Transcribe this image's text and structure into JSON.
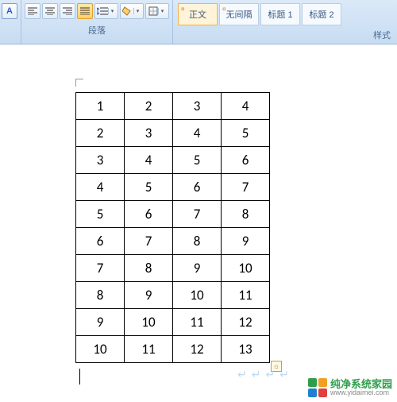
{
  "ribbon": {
    "paragraph_label": "段落",
    "styles_label": "样式",
    "styles": [
      "正文",
      "无间隔",
      "标题 1",
      "标题 2"
    ]
  },
  "table": {
    "rows": [
      [
        "1",
        "2",
        "3",
        "4"
      ],
      [
        "2",
        "3",
        "4",
        "5"
      ],
      [
        "3",
        "4",
        "5",
        "6"
      ],
      [
        "4",
        "5",
        "6",
        "7"
      ],
      [
        "5",
        "6",
        "7",
        "8"
      ],
      [
        "6",
        "7",
        "8",
        "9"
      ],
      [
        "7",
        "8",
        "9",
        "10"
      ],
      [
        "8",
        "9",
        "10",
        "11"
      ],
      [
        "9",
        "10",
        "11",
        "12"
      ],
      [
        "10",
        "11",
        "12",
        "13"
      ]
    ]
  },
  "watermark": {
    "cn": "纯净系统家园",
    "en": "www.yidaimei.com"
  }
}
